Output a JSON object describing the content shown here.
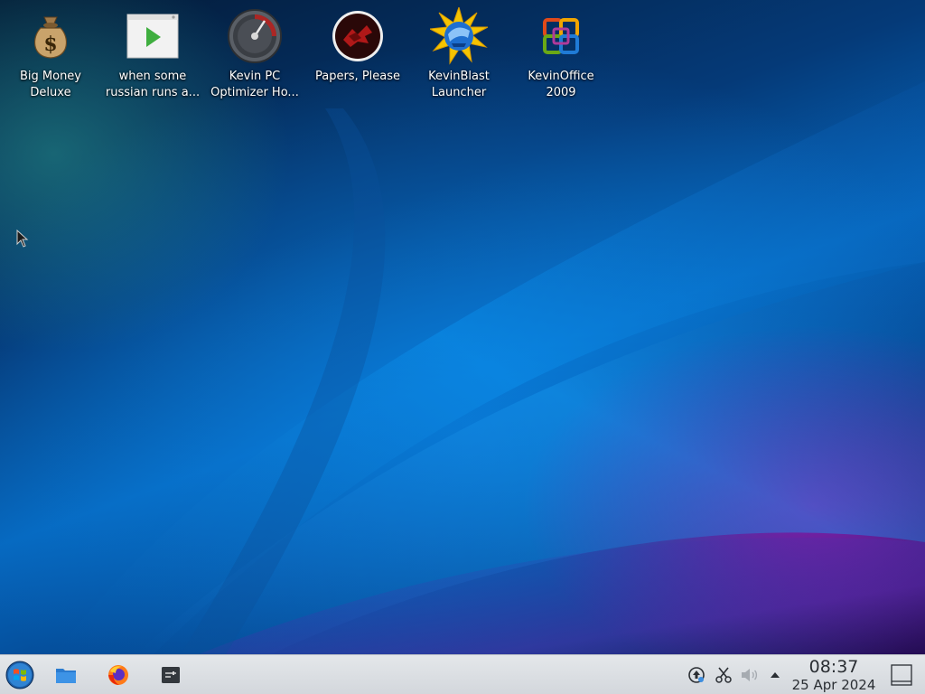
{
  "desktop": {
    "icons": [
      {
        "name": "Big Money Deluxe",
        "line1": "Big Money",
        "line2": "Deluxe",
        "icon": "money-bag-icon"
      },
      {
        "name": "when some russian runs a...",
        "line1": "when some",
        "line2": "russian runs a...",
        "icon": "video-file-icon"
      },
      {
        "name": "Kevin PC Optimizer Ho...",
        "line1": "Kevin PC",
        "line2": "Optimizer Ho...",
        "icon": "speedometer-icon"
      },
      {
        "name": "Papers, Please",
        "line1": "Papers, Please",
        "line2": "",
        "icon": "papers-please-icon"
      },
      {
        "name": "KevinBlast Launcher",
        "line1": "KevinBlast",
        "line2": "Launcher",
        "icon": "globe-starburst-icon"
      },
      {
        "name": "KevinOffice 2009",
        "line1": "KevinOffice",
        "line2": "2009",
        "icon": "office-logo-icon"
      }
    ]
  },
  "taskbar": {
    "start": {
      "icon": "start-orb-icon"
    },
    "pinned": [
      {
        "icon": "file-manager-icon"
      },
      {
        "icon": "firefox-icon"
      },
      {
        "icon": "terminal-icon"
      }
    ],
    "tray": [
      {
        "icon": "updates-icon"
      },
      {
        "icon": "clipboard-scissors-icon"
      },
      {
        "icon": "volume-icon"
      },
      {
        "icon": "tray-expand-arrow-icon"
      }
    ],
    "clock": {
      "time": "08:37",
      "date": "25 Apr 2024"
    },
    "show_desktop": {
      "icon": "show-desktop-icon"
    }
  },
  "colors": {
    "taskbar_bg": "#dcdfe3",
    "clock_text": "#2a2e33",
    "label_text": "#ffffff"
  }
}
